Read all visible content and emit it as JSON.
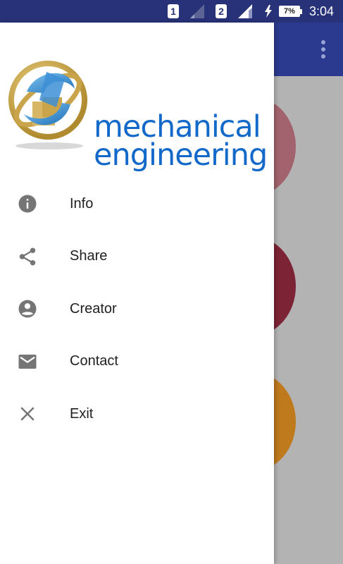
{
  "status_bar": {
    "sim1_label": "1",
    "sim2_label": "2",
    "battery_percent": "7%",
    "time": "3:04"
  },
  "app_bar": {
    "overflow_icon": "more-vert-icon",
    "color": "#2b3a8f"
  },
  "drawer": {
    "logo": {
      "line1": "mechanical",
      "line2": "engineering"
    },
    "menu": [
      {
        "icon": "info-icon",
        "label": "Info"
      },
      {
        "icon": "share-icon",
        "label": "Share"
      },
      {
        "icon": "account-circle-icon",
        "label": "Creator"
      },
      {
        "icon": "email-icon",
        "label": "Contact"
      },
      {
        "icon": "close-icon",
        "label": "Exit"
      }
    ]
  },
  "colors": {
    "status_bar": "#283279",
    "brand_blue": "#1369c9",
    "icon_gray": "#757575",
    "circle_1": "#a2636e",
    "circle_2": "#7d2336",
    "circle_3": "#bf7a1d"
  }
}
